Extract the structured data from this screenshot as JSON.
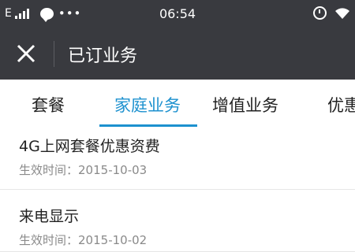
{
  "status_bar": {
    "carrier": "E",
    "dots": "•••",
    "time": "06:54"
  },
  "nav": {
    "title": "已订业务"
  },
  "tabs": [
    {
      "label": "套餐",
      "active": false
    },
    {
      "label": "家庭业务",
      "active": true
    },
    {
      "label": "增值业务",
      "active": false
    },
    {
      "label": "优惠",
      "active": false
    }
  ],
  "items": [
    {
      "title": "4G上网套餐优惠资费",
      "meta_label": "生效时间：",
      "meta_value": "2015-10-03"
    },
    {
      "title": "来电显示",
      "meta_label": "生效时间：",
      "meta_value": "2015-10-02"
    }
  ],
  "colors": {
    "bar_bg": "#393a3f",
    "accent": "#1d91cf"
  },
  "icons": {
    "close": "close-icon",
    "message": "message-icon",
    "alarm": "alarm-icon",
    "wifi": "wifi-icon",
    "signal": "signal-icon"
  }
}
